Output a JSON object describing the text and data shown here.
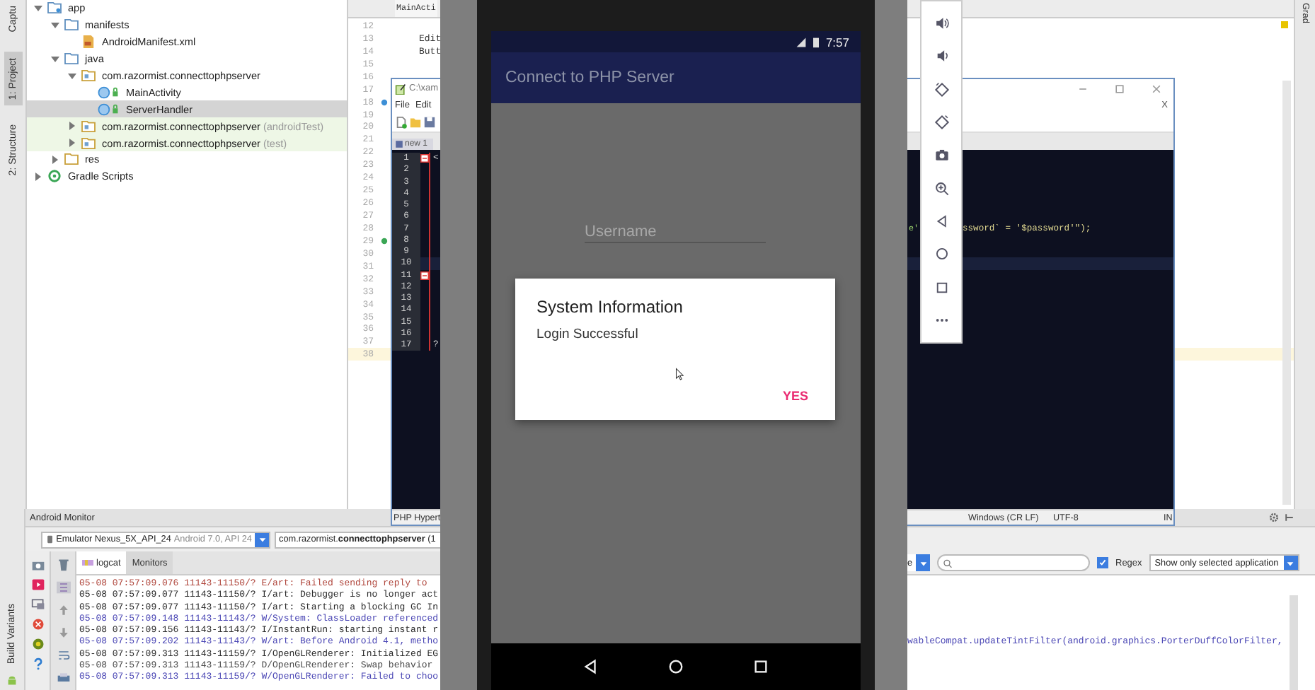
{
  "ide": {
    "tool_tabs": [
      {
        "label": "Captu",
        "selected": false
      },
      {
        "label": "1: Project",
        "selected": true
      },
      {
        "label": "2: Structure",
        "selected": false
      }
    ],
    "project_tree": [
      {
        "label": "app",
        "kind": "module",
        "expanded": true,
        "selected": false,
        "children": [
          {
            "label": "manifests",
            "kind": "folder",
            "expanded": true,
            "selected": false,
            "children": [
              {
                "label": "AndroidManifest.xml",
                "kind": "xml",
                "selected": false
              }
            ]
          },
          {
            "label": "java",
            "kind": "folder",
            "expanded": true,
            "selected": false,
            "children": [
              {
                "label": "com.razormist.connecttophpserver",
                "kind": "package",
                "expanded": true,
                "selected": false,
                "children": [
                  {
                    "label": "MainActivity",
                    "kind": "class",
                    "selected": false
                  },
                  {
                    "label": "ServerHandler",
                    "kind": "class",
                    "selected": true
                  }
                ]
              },
              {
                "label": "com.razormist.connecttophpserver",
                "suffix": "(androidTest)",
                "kind": "test-package",
                "expanded": false,
                "selected": false
              },
              {
                "label": "com.razormist.connecttophpserver",
                "suffix": "(test)",
                "kind": "test-package",
                "expanded": false,
                "selected": false
              }
            ]
          },
          {
            "label": "res",
            "kind": "resource-folder",
            "expanded": false,
            "selected": false
          }
        ]
      },
      {
        "label": "Gradle Scripts",
        "kind": "gradle",
        "expanded": false,
        "selected": false
      }
    ],
    "editor": {
      "tab": "MainActi",
      "lines": [
        {
          "number": "12",
          "current": false
        },
        {
          "number": "13",
          "text": "Edit",
          "current": false
        },
        {
          "number": "14",
          "text": "Butt",
          "current": false
        },
        {
          "number": "15",
          "current": false
        },
        {
          "number": "16",
          "current": false
        },
        {
          "number": "17",
          "current": false
        },
        {
          "number": "18",
          "current": false,
          "color": "#3d8fd6"
        },
        {
          "number": "19",
          "current": false
        },
        {
          "number": "20",
          "current": false
        },
        {
          "number": "21",
          "current": false
        },
        {
          "number": "22",
          "current": false
        },
        {
          "number": "23",
          "current": false
        },
        {
          "number": "24",
          "current": false
        },
        {
          "number": "25",
          "current": false
        },
        {
          "number": "26",
          "current": false
        },
        {
          "number": "27",
          "current": false
        },
        {
          "number": "28",
          "current": false
        },
        {
          "number": "29",
          "current": false,
          "color": "#3aa655"
        },
        {
          "number": "30",
          "current": false
        },
        {
          "number": "31",
          "current": false
        },
        {
          "number": "32",
          "current": false
        },
        {
          "number": "33",
          "current": false
        },
        {
          "number": "34",
          "current": false
        },
        {
          "number": "35",
          "current": false
        },
        {
          "number": "36",
          "current": false
        },
        {
          "number": "37",
          "current": false
        },
        {
          "number": "38",
          "current": true
        }
      ]
    },
    "right_tab": "Grad"
  },
  "monitor": {
    "title": "Android Monitor",
    "side_tab": "Build Variants",
    "device": {
      "name": "Emulator Nexus_5X_API_24",
      "detail": "Android 7.0, API 24"
    },
    "process": "com.razormist.**connecttophpserver** (1",
    "tabs": [
      {
        "label": "logcat",
        "selected": true
      },
      {
        "label": "Monitors",
        "selected": false
      }
    ],
    "filter": {
      "level": "e",
      "regex": {
        "label": "Regex",
        "checked": true
      },
      "app_filter": "Show only selected application"
    },
    "log_lines": [
      {
        "text": "05-08 07:57:09.076 11143-11150/? E/art: Failed sending reply to",
        "kind": "error"
      },
      {
        "text": "05-08 07:57:09.077 11143-11150/? I/art: Debugger is no longer act",
        "kind": "info"
      },
      {
        "text": "05-08 07:57:09.077 11143-11150/? I/art: Starting a blocking GC In",
        "kind": "info"
      },
      {
        "text": "05-08 07:57:09.148 11143-11143/? W/System: ClassLoader referenced",
        "kind": "warn"
      },
      {
        "text": "05-08 07:57:09.156 11143-11143/? I/InstantRun: starting instant r",
        "kind": "info"
      },
      {
        "text": "05-08 07:57:09.202 11143-11143/? W/art: Before Android 4.1, metho",
        "kind": "warn",
        "tail": "wableCompat.updateTintFilter(android.graphics.PorterDuffColorFilter,"
      },
      {
        "text": "05-08 07:57:09.313 11143-11159/? I/OpenGLRenderer: Initialized EG",
        "kind": "info"
      },
      {
        "text": "05-08 07:57:09.313 11143-11159/? D/OpenGLRenderer: Swap behavior",
        "kind": "debug"
      },
      {
        "text": "05-08 07:57:09.313 11143-11159/? W/OpenGLRenderer: Failed to choo",
        "kind": "warn"
      }
    ]
  },
  "notepad": {
    "title": "C:\\xam",
    "menu": [
      "File",
      "Edit"
    ],
    "doc_close": "X",
    "tab": "new 1",
    "lines": [
      {
        "number": "1",
        "fold": true,
        "current": false,
        "text": "<"
      },
      {
        "number": "2",
        "fold": false,
        "current": false
      },
      {
        "number": "3",
        "fold": false,
        "current": false
      },
      {
        "number": "4",
        "fold": false,
        "current": false
      },
      {
        "number": "5",
        "fold": false,
        "current": false
      },
      {
        "number": "6",
        "fold": false,
        "current": false
      },
      {
        "number": "7",
        "fold": false,
        "current": false,
        "fragments": [
          "e'",
          "ssword` = '$password'\");"
        ]
      },
      {
        "number": "8",
        "fold": false,
        "current": false
      },
      {
        "number": "9",
        "fold": false,
        "current": false
      },
      {
        "number": "10",
        "fold": false,
        "current": true
      },
      {
        "number": "11",
        "fold": true,
        "current": false
      },
      {
        "number": "12",
        "fold": false,
        "current": false
      },
      {
        "number": "13",
        "fold": false,
        "current": false
      },
      {
        "number": "14",
        "fold": false,
        "current": false
      },
      {
        "number": "15",
        "fold": false,
        "current": false
      },
      {
        "number": "16",
        "fold": false,
        "current": false
      },
      {
        "number": "17",
        "fold": false,
        "current": false,
        "text": "?"
      }
    ],
    "status": [
      "PHP Hypert",
      "Windows (CR LF)",
      "UTF-8",
      "IN"
    ]
  },
  "phone": {
    "time": "7:57",
    "app_title": "Connect to PHP Server",
    "username_placeholder": "Username",
    "dialog": {
      "title": "System Information",
      "message": "Login Successful",
      "button": "YES"
    }
  }
}
